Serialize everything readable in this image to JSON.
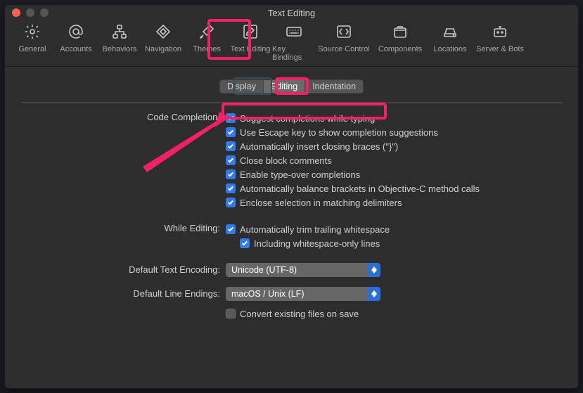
{
  "window": {
    "title": "Text Editing"
  },
  "toolbar": {
    "items": [
      {
        "label": "General"
      },
      {
        "label": "Accounts"
      },
      {
        "label": "Behaviors"
      },
      {
        "label": "Navigation"
      },
      {
        "label": "Themes"
      },
      {
        "label": "Text Editing"
      },
      {
        "label": "Key Bindings"
      },
      {
        "label": "Source Control"
      },
      {
        "label": "Components"
      },
      {
        "label": "Locations"
      },
      {
        "label": "Server & Bots"
      }
    ]
  },
  "segments": {
    "display": "Display",
    "editing": "Editing",
    "indentation": "Indentation"
  },
  "labels": {
    "code_completion": "Code Completion:",
    "while_editing": "While Editing:",
    "default_text_encoding": "Default Text Encoding:",
    "default_line_endings": "Default Line Endings:"
  },
  "checks": {
    "suggest": "Suggest completions while typing",
    "escape": "Use Escape key to show completion suggestions",
    "braces": "Automatically insert closing braces (\"}\")",
    "close_block": "Close block comments",
    "type_over": "Enable type-over completions",
    "balance": "Automatically balance brackets in Objective-C method calls",
    "enclose": "Enclose selection in matching delimiters",
    "trim": "Automatically trim trailing whitespace",
    "whitespace_only": "Including whitespace-only lines",
    "convert": "Convert existing files on save"
  },
  "selects": {
    "encoding": "Unicode (UTF-8)",
    "line_endings": "macOS / Unix (LF)"
  }
}
